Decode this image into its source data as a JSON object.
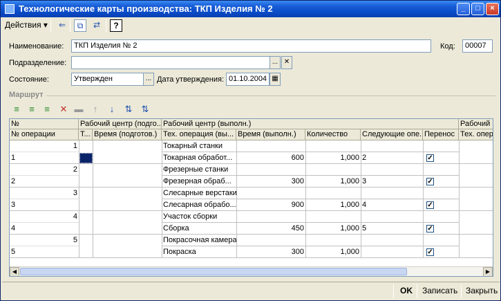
{
  "window": {
    "title": "Технологические карты производства: ТКП Изделия № 2"
  },
  "toolbar": {
    "actions_label": "Действия",
    "help": "?"
  },
  "form": {
    "name_label": "Наименование:",
    "name_value": "ТКП Изделия № 2",
    "code_label": "Код:",
    "code_value": "00007",
    "division_label": "Подразделение:",
    "division_value": "",
    "state_label": "Состояние:",
    "state_value": "Утвержден",
    "approval_label": "Дата утверждения:",
    "approval_value": "01.10.2004"
  },
  "route": {
    "section_label": "Маршрут",
    "headers_top": [
      "№",
      "Рабочий центр (подго...",
      "Рабочий центр (выполн.)",
      "Рабочий ц"
    ],
    "headers_bottom": [
      "№ операции",
      "Т...",
      "Время (подготов.)",
      "Тех. операция (вы...",
      "Время (выполн.)",
      "Количество",
      "Следующие опе...",
      "Перенос",
      "Тех. опер"
    ],
    "rows": [
      {
        "n": "1",
        "op": "1",
        "center": "Токарный станки",
        "tech": "Токарная обработ...",
        "time": "600",
        "qty": "1,000",
        "next": "2",
        "transfer": true
      },
      {
        "n": "2",
        "op": "2",
        "center": "Фрезерные станки",
        "tech": "Фрезерная обраб...",
        "time": "300",
        "qty": "1,000",
        "next": "3",
        "transfer": true
      },
      {
        "n": "3",
        "op": "3",
        "center": "Слесарные верстаки",
        "tech": "Слесарная обрабо...",
        "time": "900",
        "qty": "1,000",
        "next": "4",
        "transfer": true
      },
      {
        "n": "4",
        "op": "4",
        "center": "Участок сборки",
        "tech": "Сборка",
        "time": "450",
        "qty": "1,000",
        "next": "5",
        "transfer": true
      },
      {
        "n": "5",
        "op": "5",
        "center": "Покрасочная камера",
        "tech": "Покраска",
        "time": "300",
        "qty": "1,000",
        "next": "",
        "transfer": true
      }
    ]
  },
  "footer": {
    "ok": "OK",
    "save": "Записать",
    "close": "Закрыть"
  }
}
